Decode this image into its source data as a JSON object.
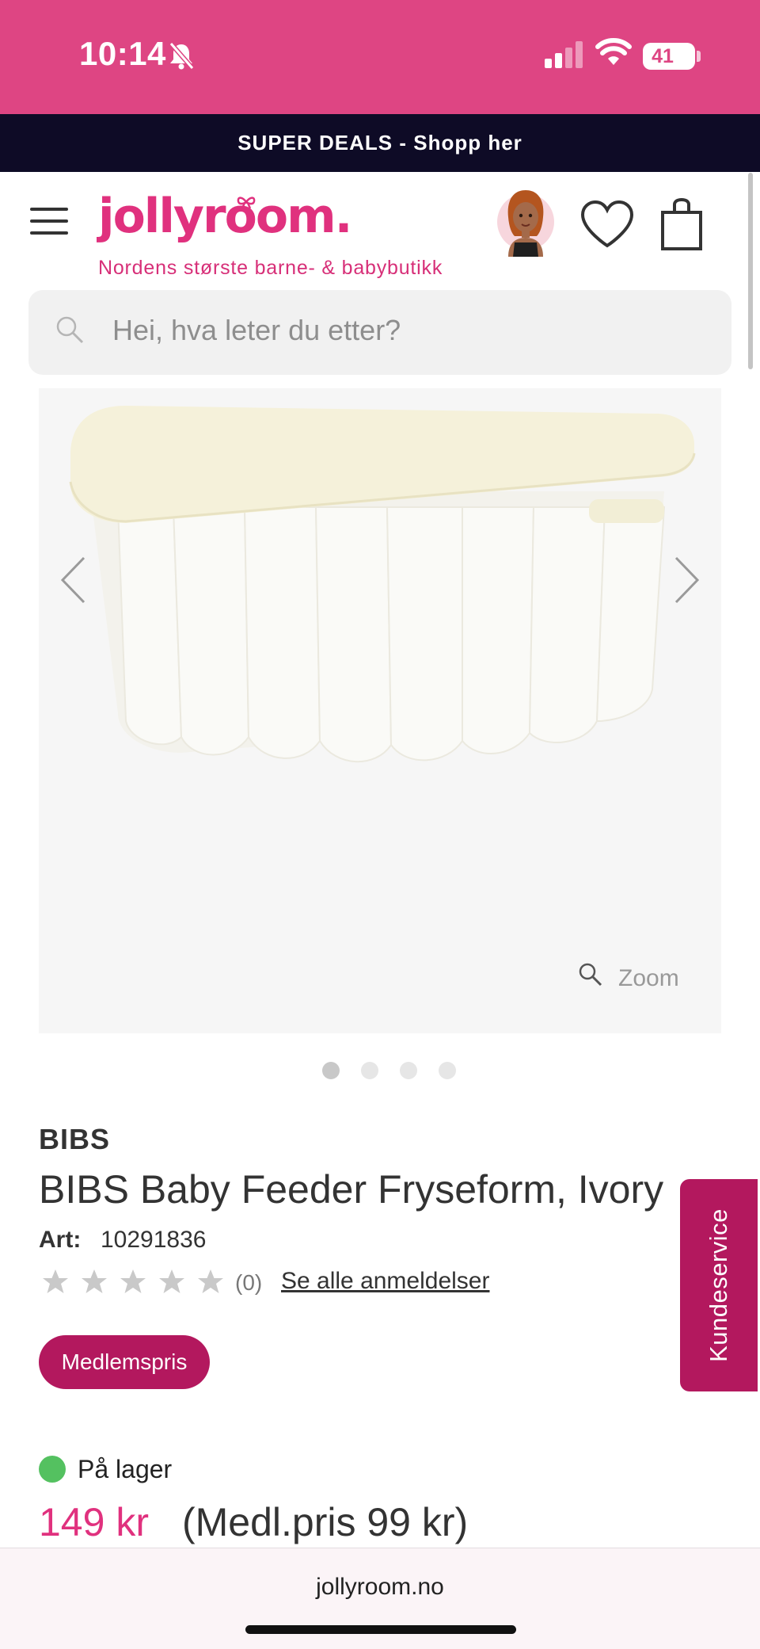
{
  "status_bar": {
    "time": "10:14",
    "battery": "41",
    "background": "#de4583"
  },
  "banner": {
    "text": "SUPER DEALS - Shopp her"
  },
  "header": {
    "logo": "jollyroom.",
    "tagline": "Nordens største barne- & babybutikk",
    "brand_color": "#e0317e"
  },
  "search": {
    "placeholder": "Hei, hva leter du etter?"
  },
  "gallery": {
    "zoom_label": "Zoom",
    "image_count": 4,
    "active_index": 0
  },
  "product": {
    "brand": "BIBS",
    "title": "BIBS Baby Feeder Fryseform, Ivory",
    "art_label": "Art:",
    "art_number": "10291836",
    "rating": 0,
    "review_count": "(0)",
    "reviews_link": "Se alle anmeldelser",
    "member_badge": "Medlemspris",
    "stock_status": "På lager",
    "price": "149 kr",
    "member_price": "(Medl.pris 99 kr)"
  },
  "side_tab": {
    "label": "Kundeservice",
    "color": "#b3185e"
  },
  "browser": {
    "url": "jollyroom.no"
  }
}
